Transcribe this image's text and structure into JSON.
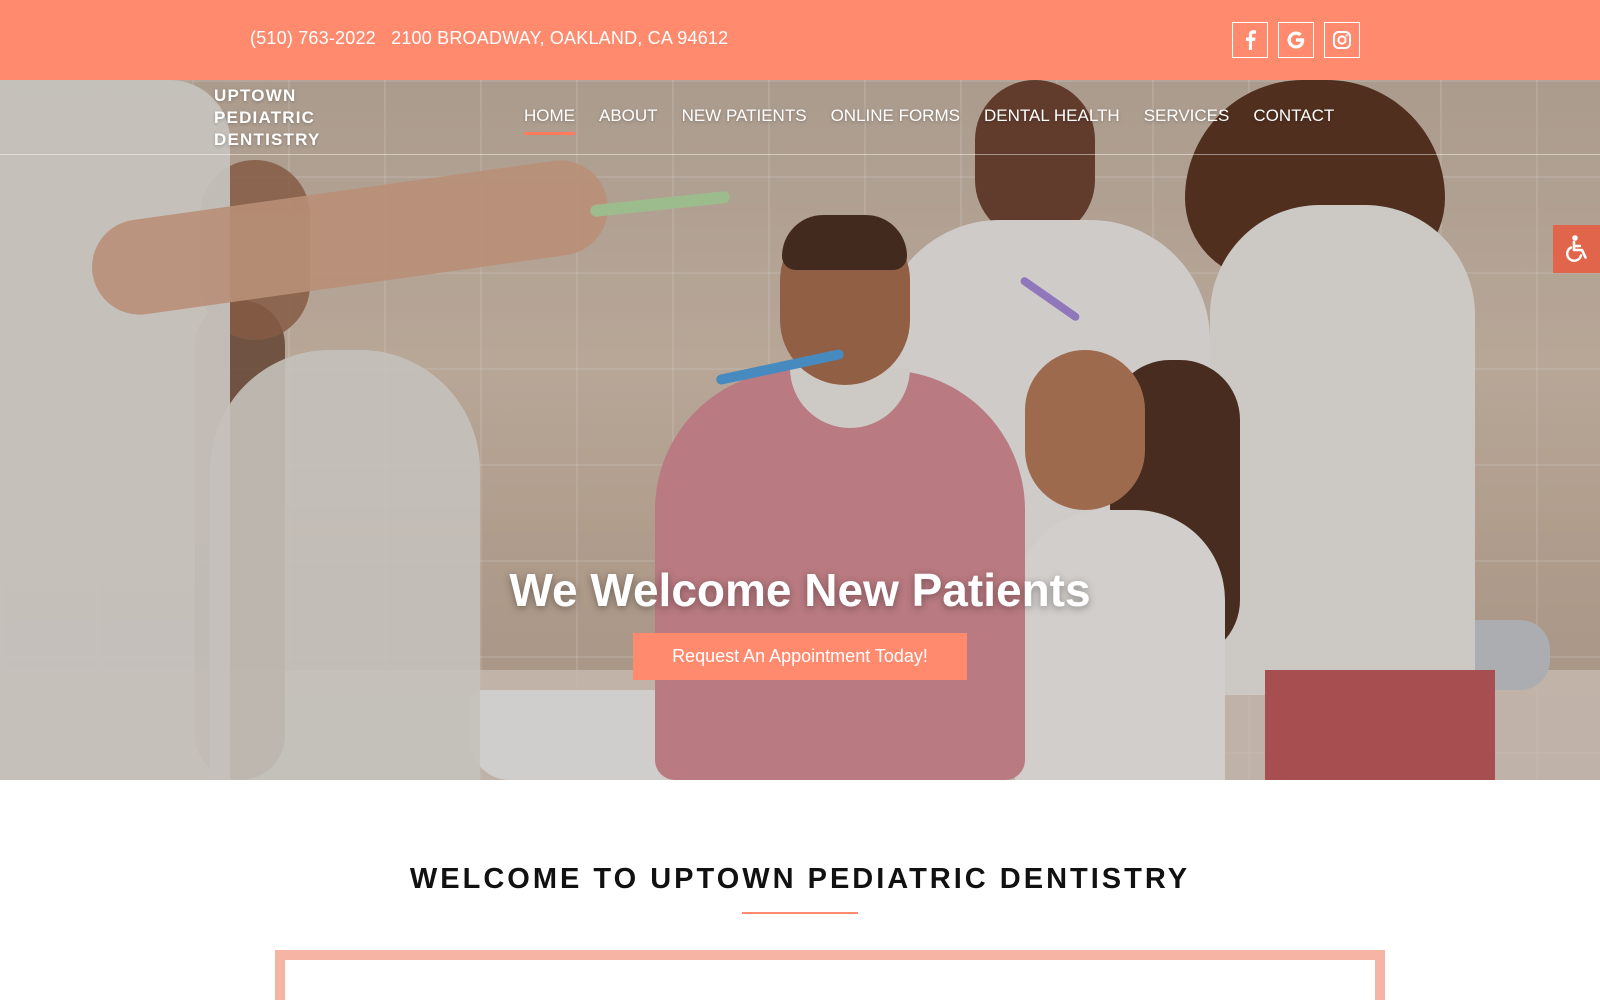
{
  "topbar": {
    "phone": "(510) 763-2022",
    "address": "2100 BROADWAY, OAKLAND, CA 94612",
    "social": [
      {
        "name": "facebook-icon"
      },
      {
        "name": "google-icon"
      },
      {
        "name": "instagram-icon"
      }
    ],
    "background_color": "#ff8a6e"
  },
  "logo": {
    "line1": "UPTOWN",
    "line2": "PEDIATRIC",
    "line3": "DENTISTRY"
  },
  "nav": {
    "items": [
      {
        "label": "HOME",
        "active": true
      },
      {
        "label": "ABOUT"
      },
      {
        "label": "NEW PATIENTS"
      },
      {
        "label": "ONLINE FORMS"
      },
      {
        "label": "DENTAL HEALTH"
      },
      {
        "label": "SERVICES"
      },
      {
        "label": "CONTACT"
      }
    ],
    "active_underline_color": "#ff7b5c"
  },
  "hero": {
    "title": "We Welcome New Patients",
    "cta_label": "Request An Appointment Today!",
    "cta_color": "#ff8a6e"
  },
  "accessibility": {
    "icon": "wheelchair-icon",
    "color": "#e0654a"
  },
  "welcome": {
    "title": "WELCOME TO UPTOWN PEDIATRIC DENTISTRY",
    "rule_color": "#ff8a6e",
    "frame_color": "#f6b4a4"
  }
}
